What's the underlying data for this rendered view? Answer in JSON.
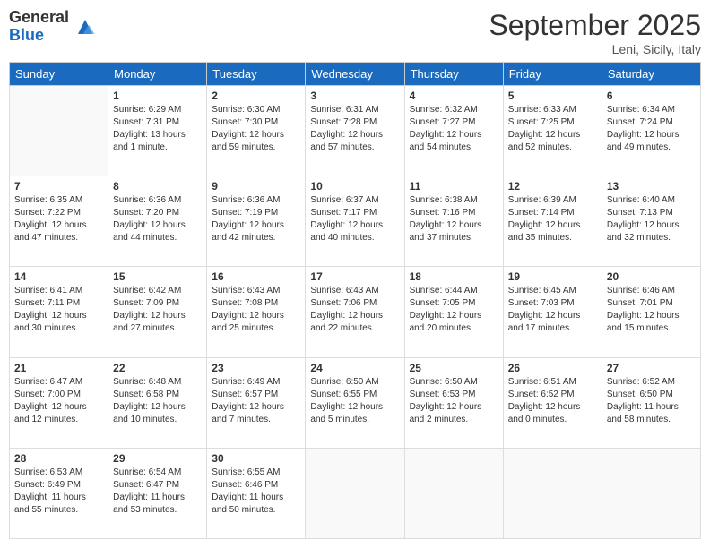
{
  "logo": {
    "general": "General",
    "blue": "Blue"
  },
  "header": {
    "title": "September 2025",
    "location": "Leni, Sicily, Italy"
  },
  "days": [
    "Sunday",
    "Monday",
    "Tuesday",
    "Wednesday",
    "Thursday",
    "Friday",
    "Saturday"
  ],
  "weeks": [
    [
      {
        "num": "",
        "info": ""
      },
      {
        "num": "1",
        "info": "Sunrise: 6:29 AM\nSunset: 7:31 PM\nDaylight: 13 hours\nand 1 minute."
      },
      {
        "num": "2",
        "info": "Sunrise: 6:30 AM\nSunset: 7:30 PM\nDaylight: 12 hours\nand 59 minutes."
      },
      {
        "num": "3",
        "info": "Sunrise: 6:31 AM\nSunset: 7:28 PM\nDaylight: 12 hours\nand 57 minutes."
      },
      {
        "num": "4",
        "info": "Sunrise: 6:32 AM\nSunset: 7:27 PM\nDaylight: 12 hours\nand 54 minutes."
      },
      {
        "num": "5",
        "info": "Sunrise: 6:33 AM\nSunset: 7:25 PM\nDaylight: 12 hours\nand 52 minutes."
      },
      {
        "num": "6",
        "info": "Sunrise: 6:34 AM\nSunset: 7:24 PM\nDaylight: 12 hours\nand 49 minutes."
      }
    ],
    [
      {
        "num": "7",
        "info": "Sunrise: 6:35 AM\nSunset: 7:22 PM\nDaylight: 12 hours\nand 47 minutes."
      },
      {
        "num": "8",
        "info": "Sunrise: 6:36 AM\nSunset: 7:20 PM\nDaylight: 12 hours\nand 44 minutes."
      },
      {
        "num": "9",
        "info": "Sunrise: 6:36 AM\nSunset: 7:19 PM\nDaylight: 12 hours\nand 42 minutes."
      },
      {
        "num": "10",
        "info": "Sunrise: 6:37 AM\nSunset: 7:17 PM\nDaylight: 12 hours\nand 40 minutes."
      },
      {
        "num": "11",
        "info": "Sunrise: 6:38 AM\nSunset: 7:16 PM\nDaylight: 12 hours\nand 37 minutes."
      },
      {
        "num": "12",
        "info": "Sunrise: 6:39 AM\nSunset: 7:14 PM\nDaylight: 12 hours\nand 35 minutes."
      },
      {
        "num": "13",
        "info": "Sunrise: 6:40 AM\nSunset: 7:13 PM\nDaylight: 12 hours\nand 32 minutes."
      }
    ],
    [
      {
        "num": "14",
        "info": "Sunrise: 6:41 AM\nSunset: 7:11 PM\nDaylight: 12 hours\nand 30 minutes."
      },
      {
        "num": "15",
        "info": "Sunrise: 6:42 AM\nSunset: 7:09 PM\nDaylight: 12 hours\nand 27 minutes."
      },
      {
        "num": "16",
        "info": "Sunrise: 6:43 AM\nSunset: 7:08 PM\nDaylight: 12 hours\nand 25 minutes."
      },
      {
        "num": "17",
        "info": "Sunrise: 6:43 AM\nSunset: 7:06 PM\nDaylight: 12 hours\nand 22 minutes."
      },
      {
        "num": "18",
        "info": "Sunrise: 6:44 AM\nSunset: 7:05 PM\nDaylight: 12 hours\nand 20 minutes."
      },
      {
        "num": "19",
        "info": "Sunrise: 6:45 AM\nSunset: 7:03 PM\nDaylight: 12 hours\nand 17 minutes."
      },
      {
        "num": "20",
        "info": "Sunrise: 6:46 AM\nSunset: 7:01 PM\nDaylight: 12 hours\nand 15 minutes."
      }
    ],
    [
      {
        "num": "21",
        "info": "Sunrise: 6:47 AM\nSunset: 7:00 PM\nDaylight: 12 hours\nand 12 minutes."
      },
      {
        "num": "22",
        "info": "Sunrise: 6:48 AM\nSunset: 6:58 PM\nDaylight: 12 hours\nand 10 minutes."
      },
      {
        "num": "23",
        "info": "Sunrise: 6:49 AM\nSunset: 6:57 PM\nDaylight: 12 hours\nand 7 minutes."
      },
      {
        "num": "24",
        "info": "Sunrise: 6:50 AM\nSunset: 6:55 PM\nDaylight: 12 hours\nand 5 minutes."
      },
      {
        "num": "25",
        "info": "Sunrise: 6:50 AM\nSunset: 6:53 PM\nDaylight: 12 hours\nand 2 minutes."
      },
      {
        "num": "26",
        "info": "Sunrise: 6:51 AM\nSunset: 6:52 PM\nDaylight: 12 hours\nand 0 minutes."
      },
      {
        "num": "27",
        "info": "Sunrise: 6:52 AM\nSunset: 6:50 PM\nDaylight: 11 hours\nand 58 minutes."
      }
    ],
    [
      {
        "num": "28",
        "info": "Sunrise: 6:53 AM\nSunset: 6:49 PM\nDaylight: 11 hours\nand 55 minutes."
      },
      {
        "num": "29",
        "info": "Sunrise: 6:54 AM\nSunset: 6:47 PM\nDaylight: 11 hours\nand 53 minutes."
      },
      {
        "num": "30",
        "info": "Sunrise: 6:55 AM\nSunset: 6:46 PM\nDaylight: 11 hours\nand 50 minutes."
      },
      {
        "num": "",
        "info": ""
      },
      {
        "num": "",
        "info": ""
      },
      {
        "num": "",
        "info": ""
      },
      {
        "num": "",
        "info": ""
      }
    ]
  ]
}
